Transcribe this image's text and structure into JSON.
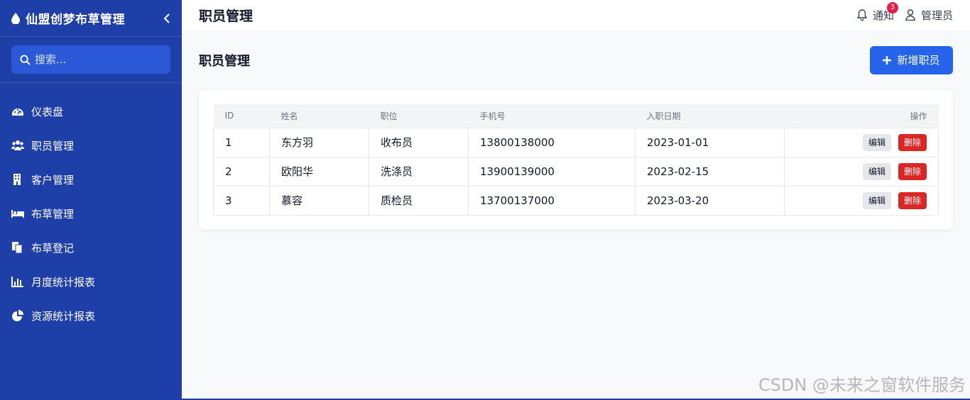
{
  "sidebar": {
    "brand": "仙盟创梦布草管理",
    "search_placeholder": "搜索...",
    "items": [
      {
        "label": "仪表盘",
        "icon": "dashboard-icon"
      },
      {
        "label": "职员管理",
        "icon": "users-icon"
      },
      {
        "label": "客户管理",
        "icon": "building-icon"
      },
      {
        "label": "布草管理",
        "icon": "bed-icon"
      },
      {
        "label": "布草登记",
        "icon": "copy-icon"
      },
      {
        "label": "月度统计报表",
        "icon": "bar-chart-icon"
      },
      {
        "label": "资源统计报表",
        "icon": "pie-chart-icon"
      }
    ]
  },
  "topbar": {
    "title": "职员管理",
    "notify_label": "通知",
    "notify_count": "3",
    "user_label": "管理员"
  },
  "main": {
    "page_title": "职员管理",
    "add_button": "新增职员",
    "table": {
      "headers": [
        "ID",
        "姓名",
        "职位",
        "手机号",
        "入职日期",
        "操作"
      ],
      "rows": [
        [
          "1",
          "东方羽",
          "收布员",
          "13800138000",
          "2023-01-01"
        ],
        [
          "2",
          "欧阳华",
          "洗涤员",
          "13900139000",
          "2023-02-15"
        ],
        [
          "3",
          "慕容",
          "质检员",
          "13700137000",
          "2023-03-20"
        ]
      ],
      "edit_label": "编辑",
      "delete_label": "删除"
    }
  },
  "watermark": "CSDN @未来之窗软件服务",
  "colors": {
    "sidebar_bg": "#1e3fa8",
    "primary": "#2563eb",
    "danger": "#dc2626"
  }
}
